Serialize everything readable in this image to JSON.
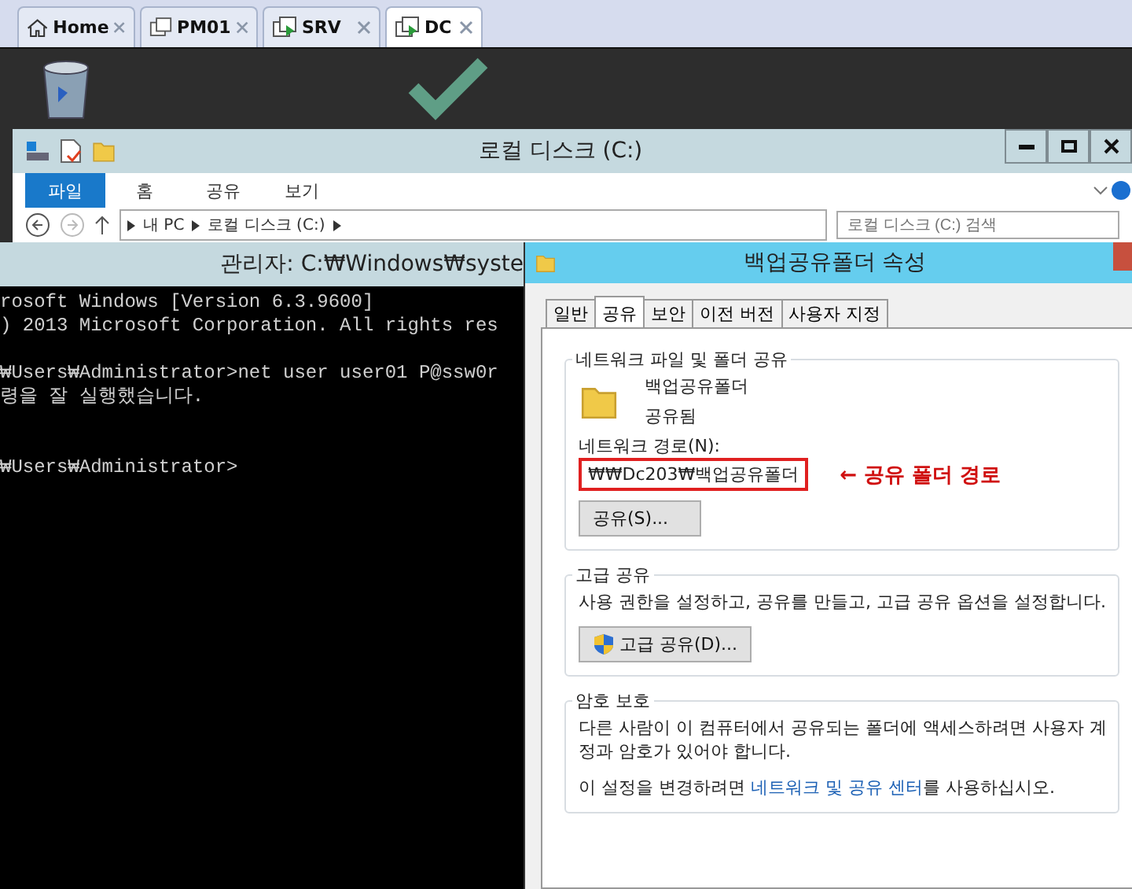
{
  "browser_tabs": [
    {
      "label": "Home",
      "kind": "home",
      "selected": false
    },
    {
      "label": "PM01",
      "kind": "vm",
      "selected": false
    },
    {
      "label": "SRV",
      "kind": "vm-running",
      "selected": false
    },
    {
      "label": "DC",
      "kind": "vm-running",
      "selected": true
    }
  ],
  "explorer": {
    "title": "로컬 디스크 (C:)",
    "ribbon_tabs": [
      {
        "label": "파일",
        "selected": true
      },
      {
        "label": "홈",
        "selected": false
      },
      {
        "label": "공유",
        "selected": false
      },
      {
        "label": "보기",
        "selected": false
      }
    ],
    "breadcrumb": [
      "내 PC",
      "로컬 디스크 (C:)"
    ],
    "search": {
      "placeholder": "로컬 디스크 (C:) 검색"
    }
  },
  "console": {
    "title": "관리자: C:₩Windows₩syste",
    "blocks": [
      [
        "rosoft Windows [Version 6.3.9600]",
        ") 2013 Microsoft Corporation. All rights res"
      ],
      [
        "₩Users₩Administrator>net user user01 P@ssw0r",
        "령을 잘 실행했습니다."
      ],
      [
        "₩Users₩Administrator>"
      ]
    ]
  },
  "properties": {
    "title": "백업공유폴더 속성",
    "tabs": [
      {
        "label": "일반",
        "selected": false
      },
      {
        "label": "공유",
        "selected": true
      },
      {
        "label": "보안",
        "selected": false
      },
      {
        "label": "이전 버전",
        "selected": false
      },
      {
        "label": "사용자 지정",
        "selected": false
      }
    ],
    "network_sharing": {
      "heading": "네트워크 파일 및 폴더 공유",
      "folder_name": "백업공유폴더",
      "status": "공유됨",
      "path_label": "네트워크 경로(N):",
      "path": "₩₩Dc203₩백업공유폴더",
      "annotation": "← 공유 폴더 경로",
      "button": "공유(S)..."
    },
    "advanced_sharing": {
      "heading": "고급 공유",
      "description": "사용 권한을 설정하고, 공유를 만들고, 고급 공유 옵션을 설정합니다.",
      "button": "고급 공유(D)..."
    },
    "password_protection": {
      "heading": "암호 보호",
      "description": "다른 사람이 이 컴퓨터에서 공유되는 폴더에 액세스하려면 사용자 계정과 암호가 있어야 합니다.",
      "note_before": "이 설정을 변경하려면 ",
      "note_link": "네트워크 및 공유 센터",
      "note_after": "를 사용하십시오."
    }
  }
}
